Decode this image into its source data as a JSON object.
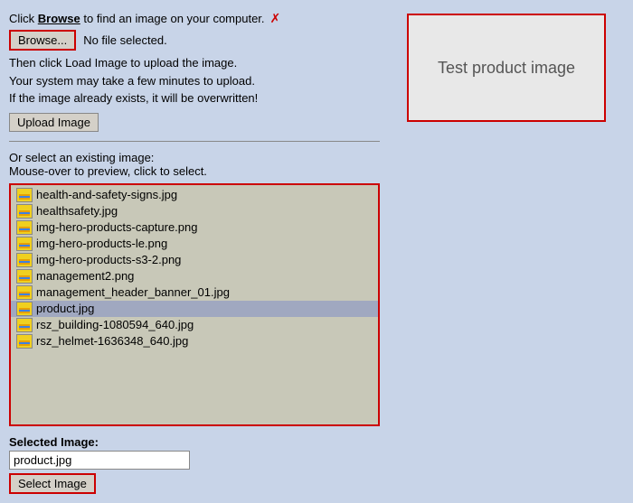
{
  "instructions": {
    "line1_prefix": "Click ",
    "line1_bold": "Browse",
    "line1_suffix": " to find an image on your computer.",
    "browse_label": "Browse...",
    "no_file": "No file selected.",
    "line2": "Then click Load Image to upload the image.",
    "line3": "Your system may take a few minutes to upload.",
    "line4": "If the image already exists, it will be overwritten!",
    "upload_button": "Upload Image",
    "or_section_line1": "Or select an existing image:",
    "or_section_line2": "Mouse-over to preview, click to select."
  },
  "file_list": {
    "items": [
      "health-and-safety-signs.jpg",
      "healthsafety.jpg",
      "img-hero-products-capture.png",
      "img-hero-products-le.png",
      "img-hero-products-s3-2.png",
      "management2.png",
      "management_header_banner_01.jpg",
      "product.jpg",
      "rsz_building-1080594_640.jpg",
      "rsz_helmet-1636348_640.jpg"
    ],
    "selected_index": 7
  },
  "selected_image": {
    "label": "Selected Image:",
    "value": "product.jpg"
  },
  "select_image_button": "Select Image",
  "preview": {
    "text": "Test product image"
  }
}
